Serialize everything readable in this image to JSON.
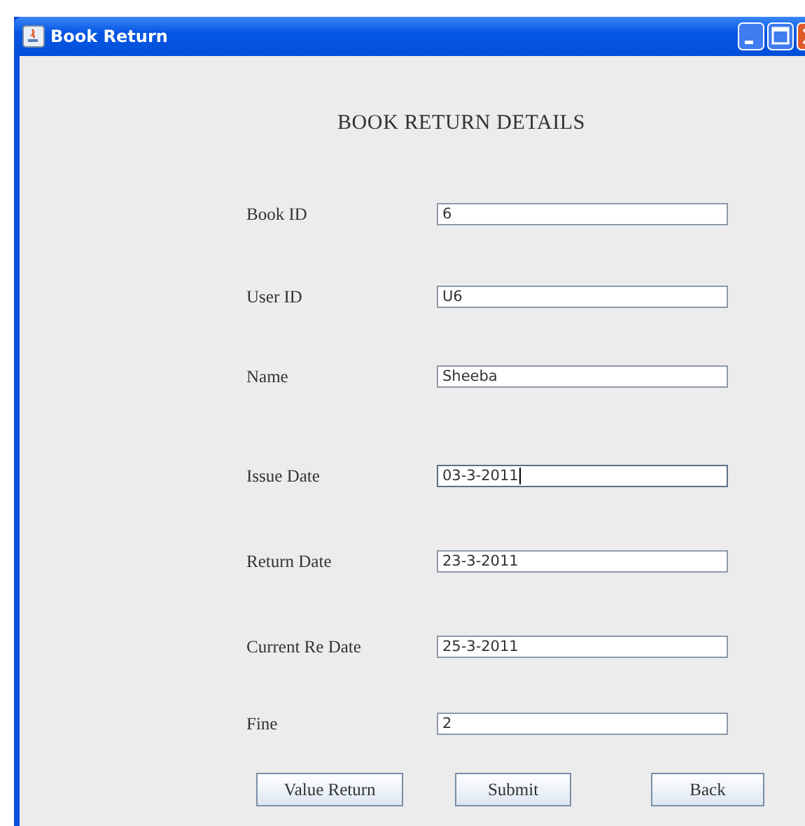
{
  "window": {
    "title": "Book Return"
  },
  "heading": "BOOK RETURN DETAILS",
  "fields": [
    {
      "label": "Book ID",
      "value": "6",
      "focused": false
    },
    {
      "label": "User ID",
      "value": "U6",
      "focused": false
    },
    {
      "label": "Name",
      "value": "Sheeba",
      "focused": false
    },
    {
      "label": "Issue Date",
      "value": "03-3-2011",
      "focused": true
    },
    {
      "label": "Return Date",
      "value": "23-3-2011",
      "focused": false
    },
    {
      "label": "Current Re Date",
      "value": "25-3-2011",
      "focused": false
    },
    {
      "label": "Fine",
      "value": "2",
      "focused": false
    }
  ],
  "buttons": [
    "Value Return",
    "Submit",
    "Back"
  ]
}
